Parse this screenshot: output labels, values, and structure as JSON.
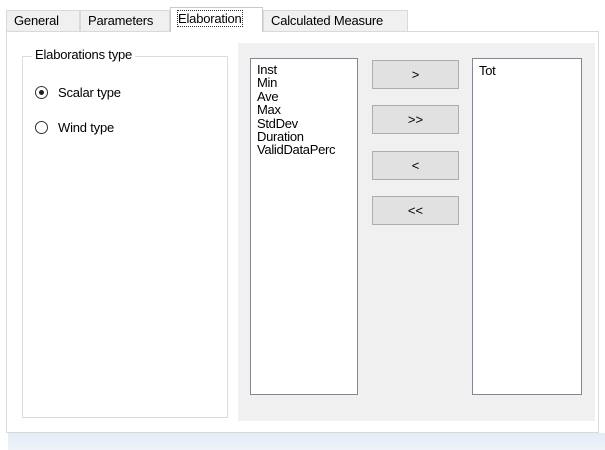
{
  "tabs": [
    {
      "label": "General",
      "active": false
    },
    {
      "label": "Parameters",
      "active": false
    },
    {
      "label": "Elaboration",
      "active": true
    },
    {
      "label": "Calculated Measure",
      "active": false
    }
  ],
  "elaborations_group": {
    "title": "Elaborations type",
    "options": [
      {
        "label": "Scalar type",
        "checked": true
      },
      {
        "label": "Wind type",
        "checked": false
      }
    ]
  },
  "available_list": {
    "items": [
      "Inst",
      "Min",
      "Ave",
      "Max",
      "StdDev",
      "Duration",
      "ValidDataPerc"
    ]
  },
  "selected_list": {
    "items": [
      "Tot"
    ]
  },
  "buttons": {
    "add": ">",
    "add_all": ">>",
    "remove": "<",
    "remove_all": "<<"
  }
}
